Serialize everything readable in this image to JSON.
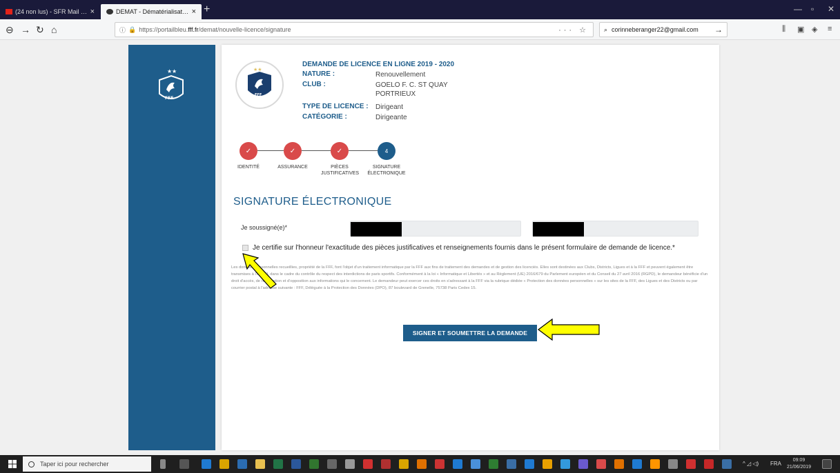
{
  "browser": {
    "tabs": [
      {
        "label": "(24 non lus) - SFR Mail | Mail"
      },
      {
        "label": "DEMAT - Dématérialisation de"
      }
    ],
    "close_glyph": "×",
    "new_tab_glyph": "+",
    "url_prefix": "https://portailbleu.",
    "url_host": "fff.fr",
    "url_path": "/demat/nouvelle-licence/signature",
    "search_value": "corinneberanger22@gmail.com"
  },
  "page": {
    "header_title": "DEMANDE DE LICENCE EN LIGNE 2019 - 2020",
    "info": [
      {
        "key": "NATURE :",
        "value": "Renouvellement"
      },
      {
        "key": "CLUB :",
        "value": "GOELO F. C. ST QUAY PORTRIEUX"
      },
      {
        "key": "TYPE DE LICENCE :",
        "value": "Dirigeant"
      },
      {
        "key": "CATÉGORIE :",
        "value": "Dirigeante"
      }
    ],
    "steps": [
      {
        "label": "IDENTITÉ",
        "state": "done",
        "glyph": "✓"
      },
      {
        "label": "ASSURANCE",
        "state": "done",
        "glyph": "✓"
      },
      {
        "label": "PIÈCES JUSTIFICATIVES",
        "state": "done",
        "glyph": "✓"
      },
      {
        "label": "SIGNATURE ÉLECTRONIQUE",
        "state": "current",
        "glyph": "4"
      }
    ],
    "section_title": "SIGNATURE ÉLECTRONIQUE",
    "field_label": "Je soussigné(e)*",
    "certify_text": "Je certifie sur l'honneur l'exactitude des pièces justificatives et renseignements fournis dans le présent formulaire de demande de licence.*",
    "legal_text": "Les données personnelles recueillies, propriété de la FFF, font l'objet d'un traitement informatique par la FFF aux fins de traitement des demandes et de gestion des licenciés. Elles sont destinées aux Clubs, Districts, Ligues et à la FFF et peuvent également être transmises à l'ARJEL dans le cadre du contrôle du respect des interdictions de paris sportifs. Conformément à la loi « Informatique et Libertés » et au Règlement (UE) 2016/679 du Parlement européen et du Conseil du 27 avril 2016 (RGPD), le demandeur bénéficie d'un droit d'accès, de rectification et d'opposition aux informations qui le concernent. Le demandeur peut exercer ces droits en s'adressant à la FFF via la rubrique dédiée « Protection des données personnelles » sur les sites de la FFF, des Ligues et des Districts ou par courrier postal à l'adresse suivante : FFF, Déléguée à la Protection des Données (DPO), 87 boulevard de Grenelle, 75738 Paris Cedex 15.",
    "submit_label": "SIGNER ET SOUMETTRE LA DEMANDE",
    "logo_text": "FFF"
  },
  "taskbar": {
    "search_placeholder": "Taper ici pour rechercher",
    "tray_lang": "FRA",
    "time": "09:09",
    "date": "21/06/2019"
  },
  "colors": {
    "brand_blue": "#1e5d8b",
    "step_done": "#d94a4a",
    "annotation_arrow": "#ffff00"
  }
}
